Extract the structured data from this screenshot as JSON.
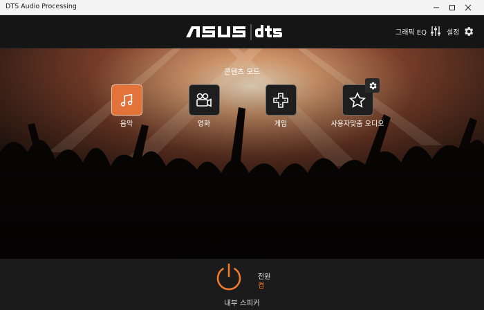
{
  "window": {
    "title": "DTS Audio Processing",
    "controls": [
      "minimize",
      "maximize",
      "close"
    ]
  },
  "header": {
    "brand_left": "ASUS",
    "brand_right": "dts",
    "graphic_eq_label": "그래픽 EQ",
    "graphic_eq_icon": "sliders-icon",
    "settings_label": "설정",
    "settings_icon": "gear-icon"
  },
  "content_mode": {
    "title": "콘텐츠 모드",
    "selected": "음악",
    "modes": [
      {
        "label": "음악",
        "icon": "music-note-icon",
        "active": true
      },
      {
        "label": "영화",
        "icon": "movie-camera-icon",
        "active": false
      },
      {
        "label": "게임",
        "icon": "gamepad-icon",
        "active": false
      },
      {
        "label": "사용자맞춤 오디오",
        "icon": "star-icon",
        "active": false,
        "has_settings": true
      }
    ]
  },
  "power": {
    "label": "전원",
    "state": "켬",
    "output_device": "내부 스피커"
  },
  "colors": {
    "accent": "#e4733a",
    "power": "#f07a2b",
    "header_bg": "#151515",
    "footer_bg": "#1b1b1b"
  }
}
